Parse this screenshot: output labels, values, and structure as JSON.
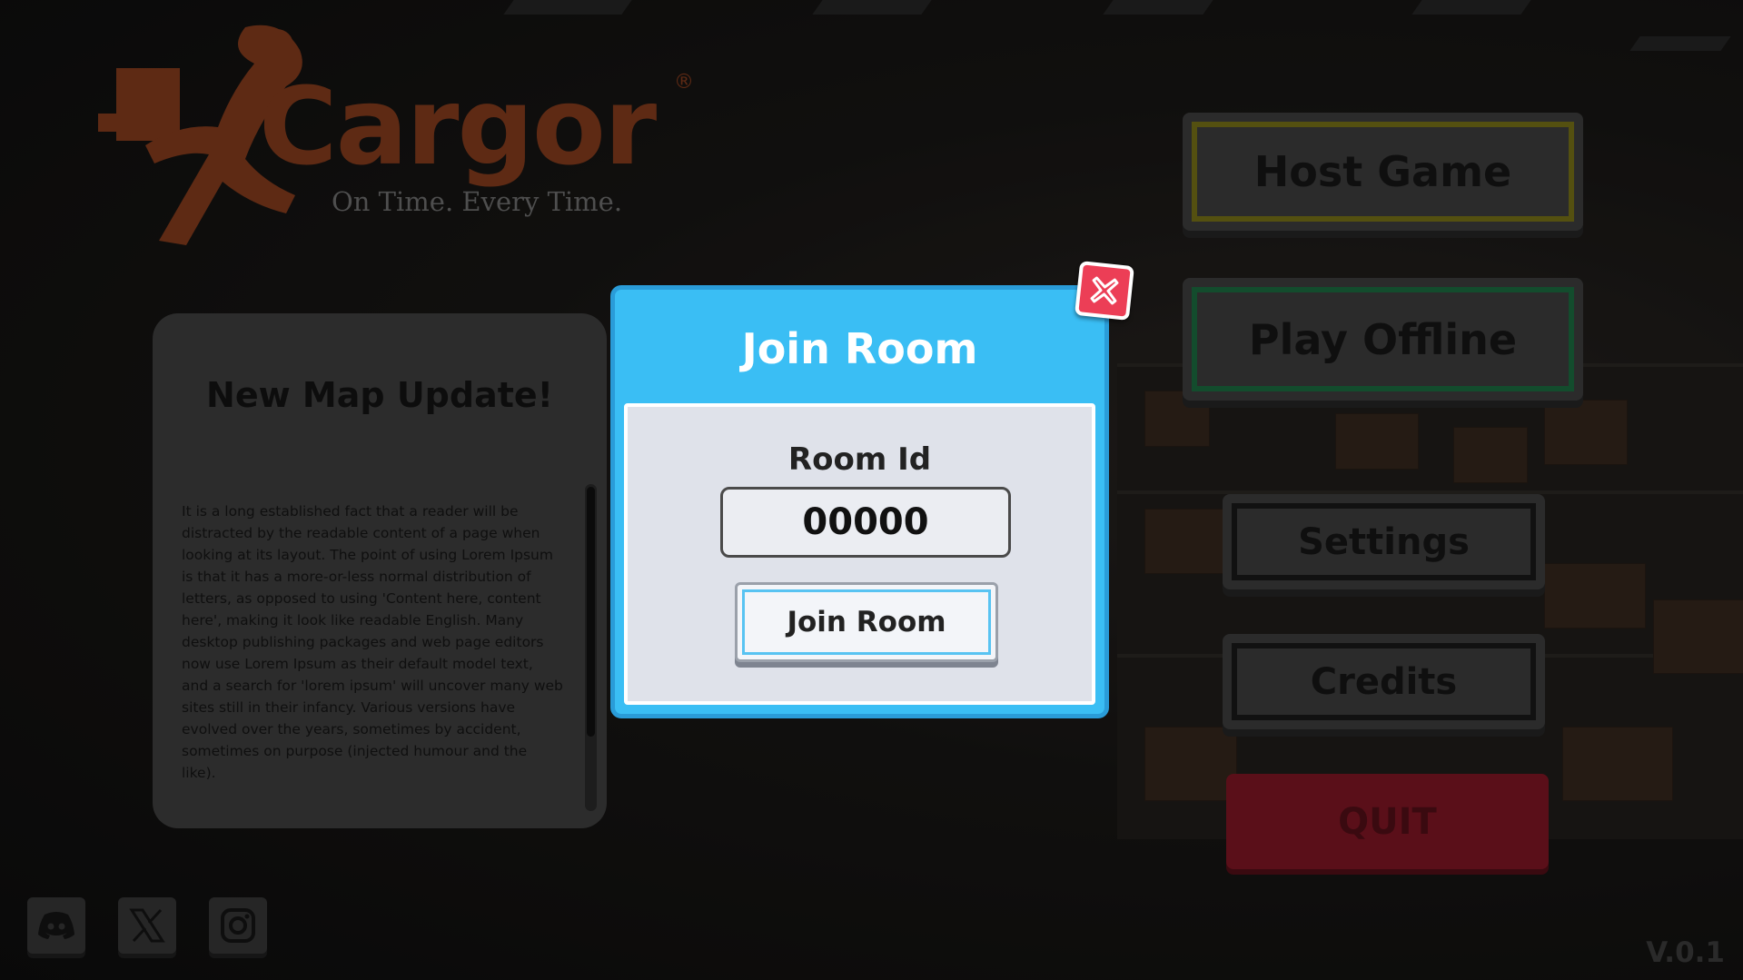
{
  "brand": {
    "name": "Cargor",
    "registered": "®",
    "tagline": "On Time. Every Time."
  },
  "news": {
    "title": "New Map Update!",
    "body": "It is a long established fact that a reader will be distracted by the readable content of a page when looking at its layout. The point of using Lorem Ipsum is that it has a more-or-less normal distribution of letters, as opposed to using 'Content here, content here', making it look like readable English. Many desktop publishing packages and web page editors now use Lorem Ipsum as their default model text, and a search for 'lorem ipsum' will uncover many web sites still in their infancy. Various versions have evolved over the years, sometimes by accident, sometimes on purpose (injected humour and the like)."
  },
  "menu": {
    "host": "Host Game",
    "offline": "Play Offline",
    "settings": "Settings",
    "credits": "Credits",
    "quit": "QUIT"
  },
  "modal": {
    "title": "Join Room",
    "room_label": "Room Id",
    "room_value": "00000",
    "join_button": "Join Room"
  },
  "social": {
    "icons": [
      "discord-icon",
      "x-icon",
      "instagram-icon"
    ]
  },
  "version": "V.0.1",
  "colors": {
    "modal_accent": "#3abef4",
    "close_red": "#ec3e56",
    "logo_orange": "#5e2a14",
    "quit_red": "#5a0f19"
  }
}
